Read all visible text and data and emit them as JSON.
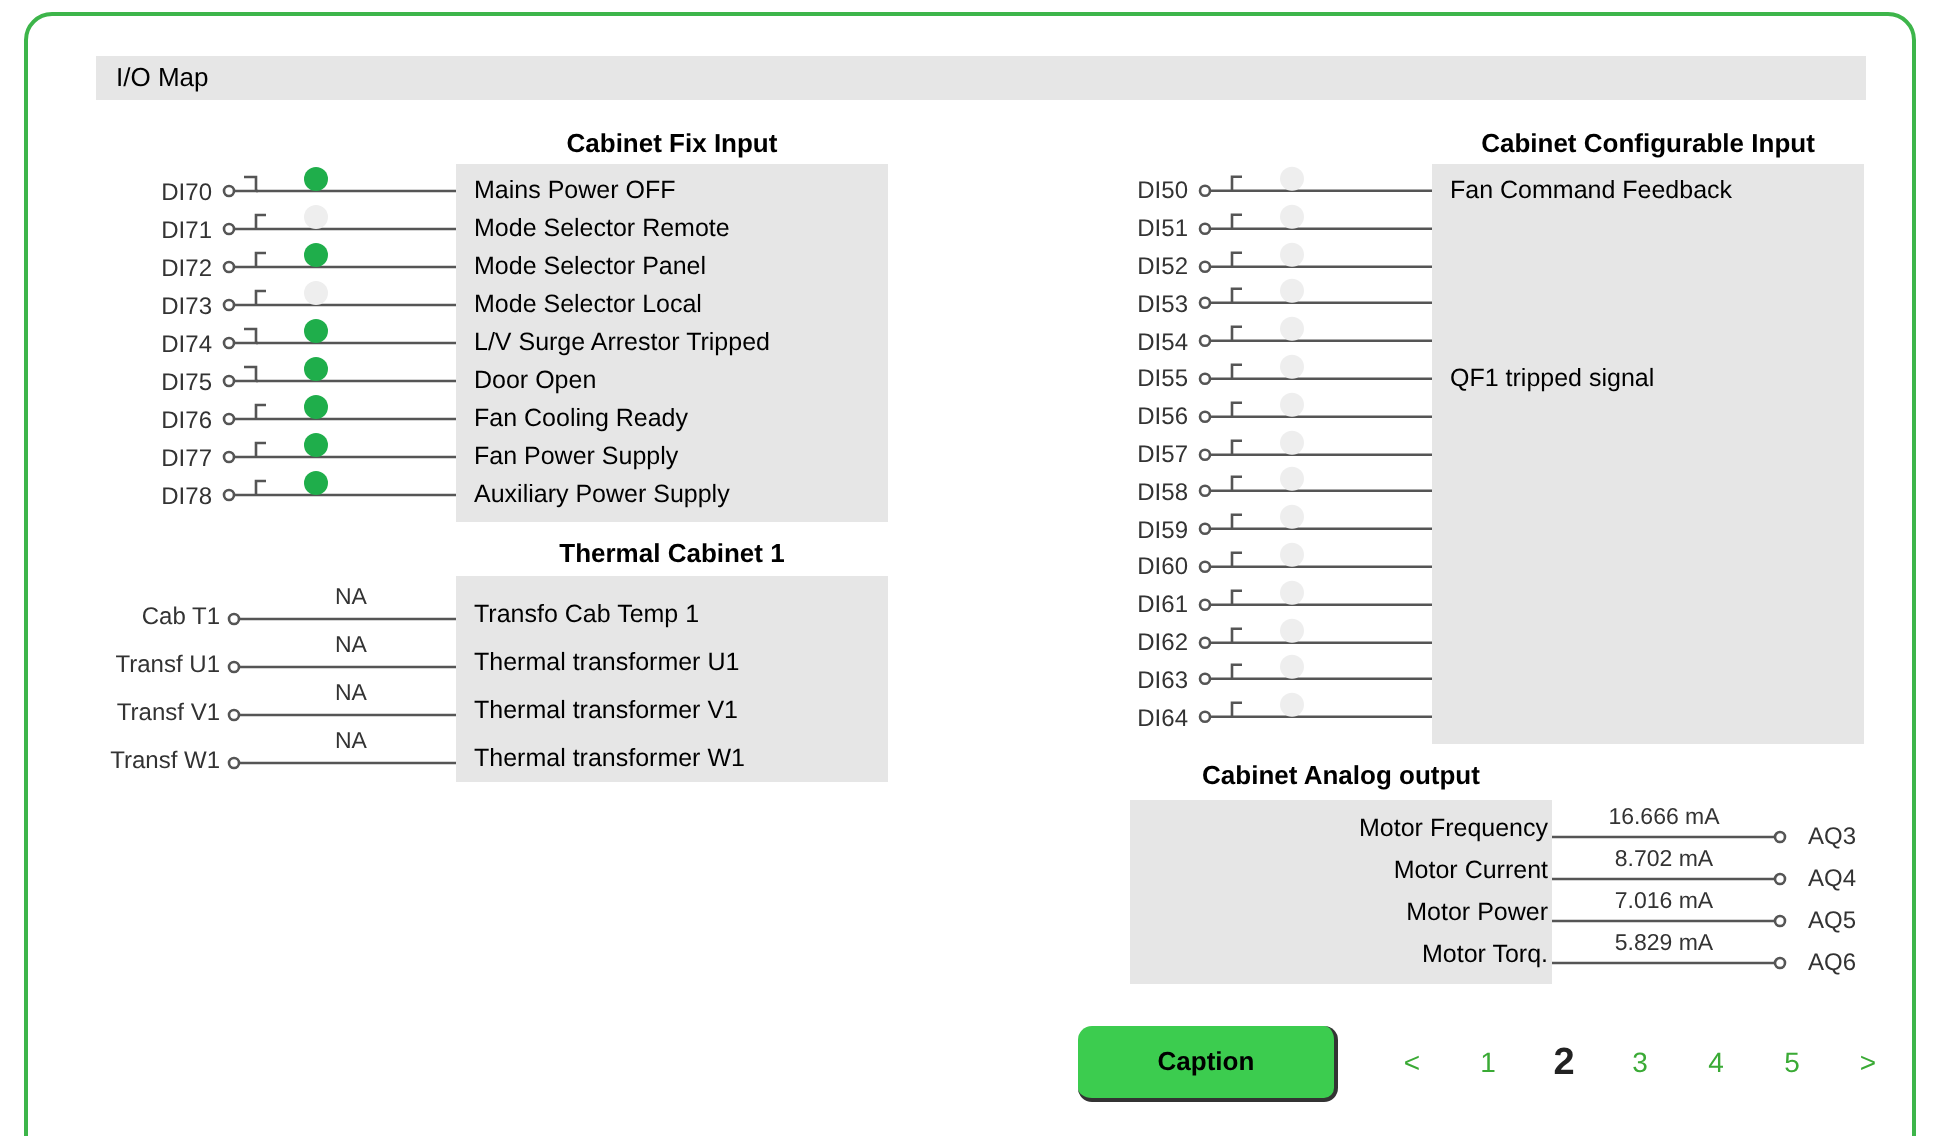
{
  "title": "I/O Map",
  "fix_input": {
    "title": "Cabinet Fix Input",
    "rows": [
      {
        "label": "DI70",
        "kind": "closed",
        "lamp_on": true,
        "description": "Mains Power OFF"
      },
      {
        "label": "DI71",
        "kind": "open",
        "lamp_on": false,
        "description": "Mode Selector Remote"
      },
      {
        "label": "DI72",
        "kind": "open",
        "lamp_on": true,
        "description": "Mode Selector Panel"
      },
      {
        "label": "DI73",
        "kind": "open",
        "lamp_on": false,
        "description": "Mode Selector Local"
      },
      {
        "label": "DI74",
        "kind": "closed",
        "lamp_on": true,
        "description": "L/V Surge Arrestor Tripped"
      },
      {
        "label": "DI75",
        "kind": "closed",
        "lamp_on": true,
        "description": "Door Open"
      },
      {
        "label": "DI76",
        "kind": "open",
        "lamp_on": true,
        "description": "Fan Cooling Ready"
      },
      {
        "label": "DI77",
        "kind": "open",
        "lamp_on": true,
        "description": "Fan Power Supply"
      },
      {
        "label": "DI78",
        "kind": "open",
        "lamp_on": true,
        "description": "Auxiliary Power Supply"
      }
    ]
  },
  "thermal": {
    "title": "Thermal Cabinet 1",
    "rows": [
      {
        "label": "Cab T1",
        "value": "NA",
        "description": "Transfo Cab Temp 1"
      },
      {
        "label": "Transf U1",
        "value": "NA",
        "description": "Thermal transformer U1"
      },
      {
        "label": "Transf V1",
        "value": "NA",
        "description": "Thermal transformer V1"
      },
      {
        "label": "Transf W1",
        "value": "NA",
        "description": "Thermal transformer W1"
      }
    ]
  },
  "configurable_input": {
    "title": "Cabinet Configurable Input",
    "rows": [
      {
        "label": "DI50",
        "kind": "open",
        "lamp_on": false,
        "description": "Fan Command Feedback"
      },
      {
        "label": "DI51",
        "kind": "open",
        "lamp_on": false
      },
      {
        "label": "DI52",
        "kind": "open",
        "lamp_on": false
      },
      {
        "label": "DI53",
        "kind": "open",
        "lamp_on": false
      },
      {
        "label": "DI54",
        "kind": "open",
        "lamp_on": false
      },
      {
        "label": "DI55",
        "kind": "open",
        "lamp_on": false,
        "description": "QF1 tripped signal"
      },
      {
        "label": "DI56",
        "kind": "open",
        "lamp_on": false
      },
      {
        "label": "DI57",
        "kind": "open",
        "lamp_on": false
      },
      {
        "label": "DI58",
        "kind": "open",
        "lamp_on": false
      },
      {
        "label": "DI59",
        "kind": "open",
        "lamp_on": false
      },
      {
        "label": "DI60",
        "kind": "open",
        "lamp_on": false
      },
      {
        "label": "DI61",
        "kind": "open",
        "lamp_on": false
      },
      {
        "label": "DI62",
        "kind": "open",
        "lamp_on": false
      },
      {
        "label": "DI63",
        "kind": "open",
        "lamp_on": false
      },
      {
        "label": "DI64",
        "kind": "open",
        "lamp_on": false
      }
    ]
  },
  "analog_output": {
    "title": "Cabinet Analog output",
    "rows": [
      {
        "description": "Motor Frequency",
        "value": "16.666 mA",
        "label": "AQ3"
      },
      {
        "description": "Motor Current",
        "value": "8.702 mA",
        "label": "AQ4"
      },
      {
        "description": "Motor Power",
        "value": "7.016 mA",
        "label": "AQ5"
      },
      {
        "description": "Motor Torq.",
        "value": "5.829 mA",
        "label": "AQ6"
      }
    ]
  },
  "caption_button": "Caption",
  "pagination": {
    "prev": "<",
    "next": ">",
    "pages": [
      {
        "label": "1",
        "selected": false
      },
      {
        "label": "2",
        "selected": true
      },
      {
        "label": "3",
        "selected": false
      },
      {
        "label": "4",
        "selected": false
      },
      {
        "label": "5",
        "selected": false
      }
    ]
  }
}
